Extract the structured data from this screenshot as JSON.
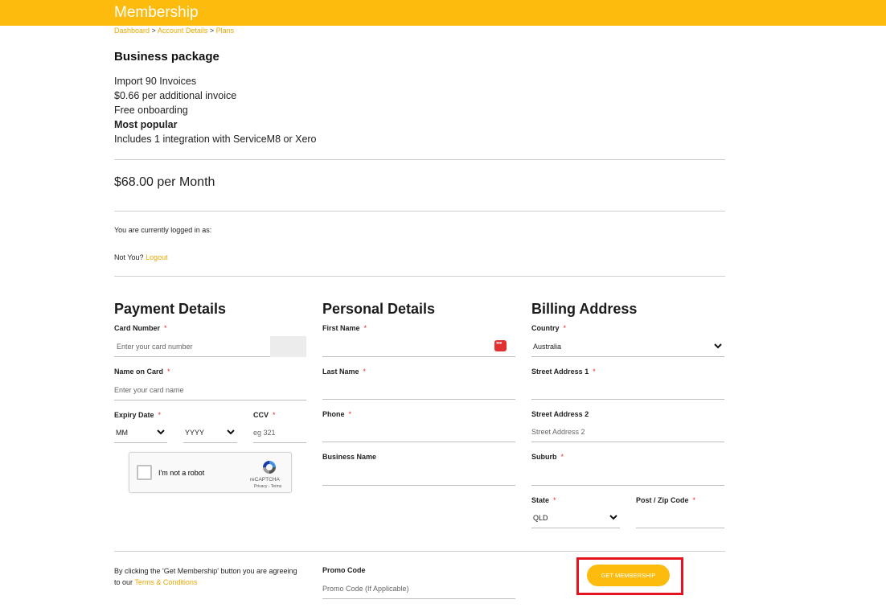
{
  "header": {
    "title": "Membership"
  },
  "breadcrumb": {
    "dashboard": "Dashboard",
    "sep1": ">",
    "account": "Account Details",
    "sep2": ">",
    "plans": "Plans"
  },
  "package": {
    "title": "Business package",
    "features": [
      "Import 90 Invoices",
      "$0.66 per additional invoice",
      "Free onboarding"
    ],
    "highlight": "Most popular",
    "extra": "Includes 1 integration with ServiceM8 or Xero",
    "price": "$68.00 per Month"
  },
  "session": {
    "logged_in_text": "You are currently logged in as:",
    "not_you": "Not You?",
    "logout": "Logout"
  },
  "payment": {
    "title": "Payment Details",
    "card_number_label": "Card Number",
    "card_number_placeholder": "Enter your card number",
    "name_on_card_label": "Name on Card",
    "name_on_card_placeholder": "Enter your card name",
    "expiry_label": "Expiry Date",
    "month_value": "MM",
    "year_value": "YYYY",
    "ccv_label": "CCV",
    "ccv_placeholder": "eg 321",
    "required_mark": "*"
  },
  "captcha": {
    "label": "I'm not a robot",
    "brand": "reCAPTCHA",
    "terms": "Privacy - Terms"
  },
  "personal": {
    "title": "Personal Details",
    "first_name_label": "First Name",
    "last_name_label": "Last Name",
    "phone_label": "Phone",
    "business_label": "Business Name"
  },
  "billing": {
    "title": "Billing Address",
    "country_label": "Country",
    "country_value": "Australia",
    "street1_label": "Street Address 1",
    "street2_label": "Street Address 2",
    "street2_placeholder": "Street Address 2",
    "suburb_label": "Suburb",
    "state_label": "State",
    "state_value": "QLD",
    "postcode_label": "Post / Zip Code"
  },
  "footer": {
    "agree_text": "By clicking the 'Get Membership' button you are agreeing to our",
    "terms_link": "Terms & Conditions",
    "promo_label": "Promo Code",
    "promo_placeholder": "Promo Code (If Applicable)",
    "cta_label": "GET MEMBERSHIP"
  },
  "colors": {
    "brand": "#fdbb0e",
    "required": "#e22233",
    "highlight_box": "#e3141f"
  }
}
